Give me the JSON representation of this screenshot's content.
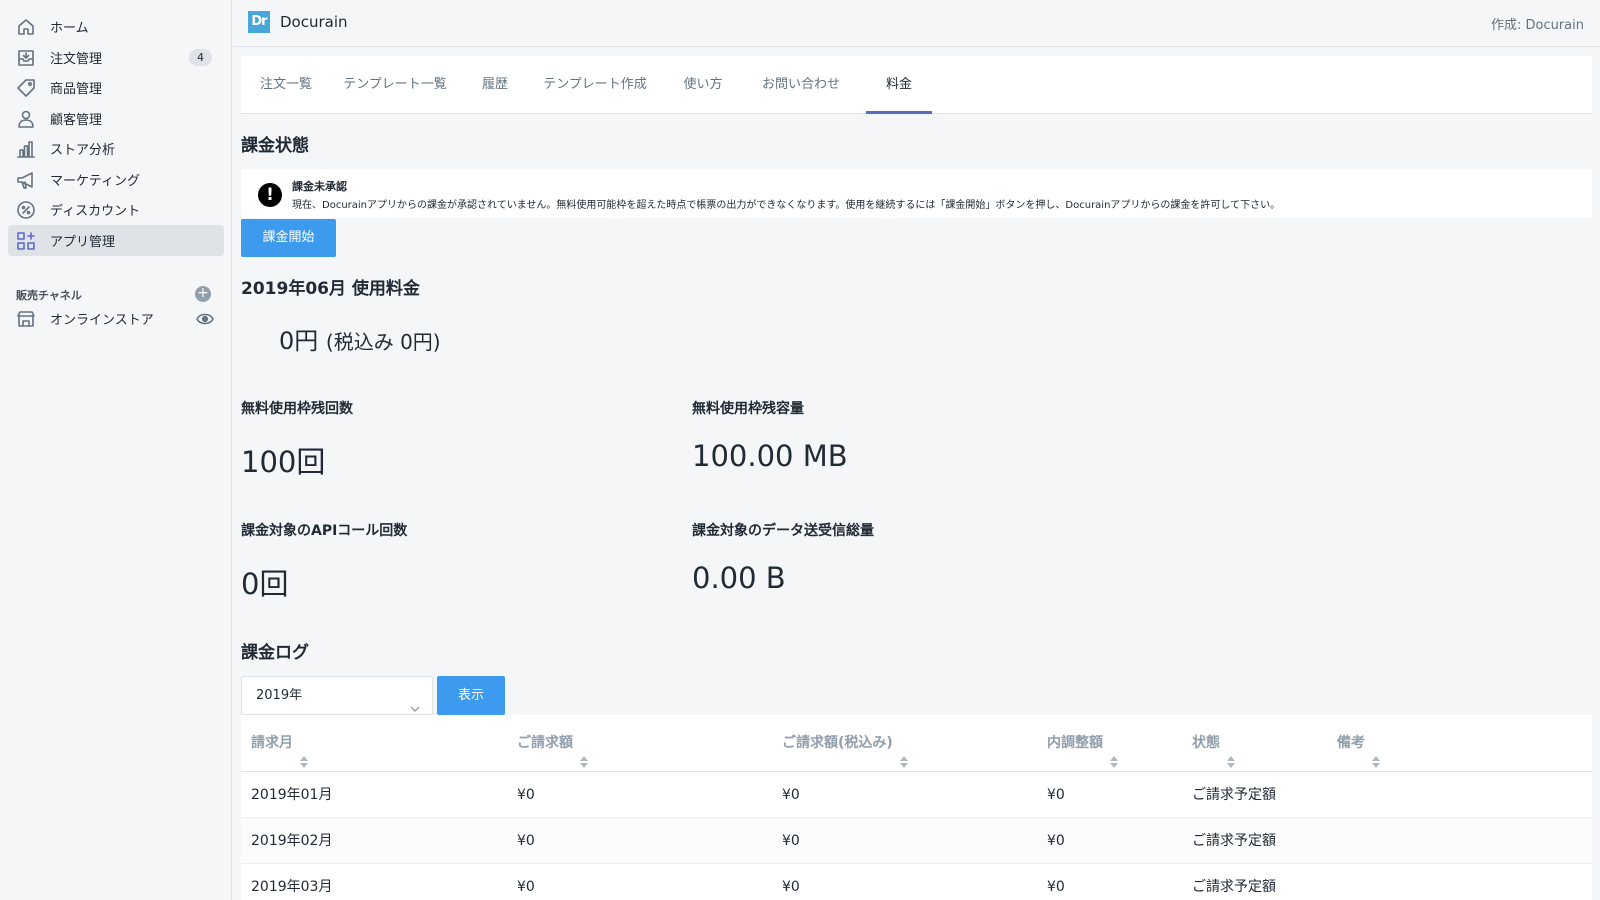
{
  "sidebar": {
    "items": [
      {
        "label": "ホーム"
      },
      {
        "label": "注文管理",
        "badge": "4"
      },
      {
        "label": "商品管理"
      },
      {
        "label": "顧客管理"
      },
      {
        "label": "ストア分析"
      },
      {
        "label": "マーケティング"
      },
      {
        "label": "ディスカウント"
      },
      {
        "label": "アプリ管理"
      }
    ],
    "channels_title": "販売チャネル",
    "channels": [
      {
        "label": "オンラインストア"
      }
    ]
  },
  "topbar": {
    "logo_text": "Dr",
    "app_title": "Docurain",
    "created_by": "作成: Docurain"
  },
  "tabs": [
    {
      "label": "注文一覧"
    },
    {
      "label": "テンプレート一覧"
    },
    {
      "label": "履歴"
    },
    {
      "label": "テンプレート作成"
    },
    {
      "label": "使い方"
    },
    {
      "label": "お問い合わせ"
    },
    {
      "label": "料金"
    }
  ],
  "billing": {
    "status_heading": "課金状態",
    "banner_title": "課金未承認",
    "banner_message": "現在、Docurainアプリからの課金が承認されていません。無料使用可能枠を超えた時点で帳票の出力ができなくなります。使用を継続するには「課金開始」ボタンを押し、Docurainアプリからの課金を許可して下さい。",
    "start_button": "課金開始",
    "usage_heading": "2019年06月 使用料金",
    "price": "0円",
    "price_tax": "(税込み 0円)",
    "stats": {
      "free_calls_label": "無料使用枠残回数",
      "free_calls_value": "100回",
      "free_capacity_label": "無料使用枠残容量",
      "free_capacity_value": "100.00 MB",
      "api_calls_label": "課金対象のAPIコール回数",
      "api_calls_value": "0回",
      "transfer_label": "課金対象のデータ送受信総量",
      "transfer_value": "0.00 B"
    }
  },
  "log": {
    "heading": "課金ログ",
    "year_select": "2019年",
    "show_button": "表示",
    "columns": [
      "請求月",
      "ご請求額",
      "ご請求額(税込み)",
      "内調整額",
      "状態",
      "備考"
    ],
    "rows": [
      [
        "2019年01月",
        "¥0",
        "¥0",
        "¥0",
        "ご請求予定額",
        ""
      ],
      [
        "2019年02月",
        "¥0",
        "¥0",
        "¥0",
        "ご請求予定額",
        ""
      ],
      [
        "2019年03月",
        "¥0",
        "¥0",
        "¥0",
        "ご請求予定額",
        ""
      ]
    ]
  },
  "colors": {
    "accent": "#3d9bef",
    "tab_indicator": "#5c6ac4",
    "logo": "#47a7dc"
  },
  "icons": [
    "home-icon",
    "orders-icon",
    "tag-icon",
    "user-icon",
    "chart-icon",
    "megaphone-icon",
    "discount-icon",
    "apps-icon",
    "plus-circle-icon",
    "store-icon",
    "eye-icon",
    "alert-icon",
    "chevron-down-icon",
    "sort-icon"
  ]
}
